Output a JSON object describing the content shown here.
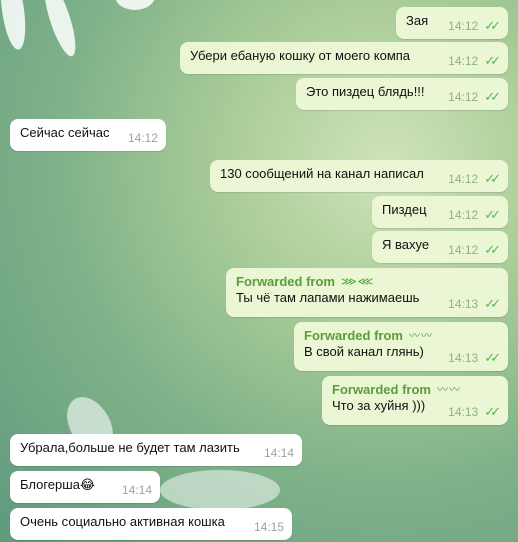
{
  "messages": [
    {
      "text": "Зая",
      "time": "14:12"
    },
    {
      "text": "Убери ебаную кошку от моего компа",
      "time": "14:12"
    },
    {
      "text": "Это пиздец блядь!!!",
      "time": "14:12"
    },
    {
      "text": "Сейчас сейчас",
      "time": "14:12"
    },
    {
      "text": "130 сообщений на канал написал",
      "time": "14:12"
    },
    {
      "text": "Пиздец",
      "time": "14:12"
    },
    {
      "text": "Я вахуе",
      "time": "14:12"
    },
    {
      "forwarded": "Forwarded from",
      "from_name": "⋙⋘",
      "text": "Ты чё там лапами нажимаешь",
      "time": "14:13"
    },
    {
      "forwarded": "Forwarded from",
      "from_name": "〰〰",
      "text": "В свой канал глянь)",
      "time": "14:13"
    },
    {
      "forwarded": "Forwarded from",
      "from_name": "〰〰",
      "text": "Что за хуйня )))",
      "time": "14:13"
    },
    {
      "text": "Убрала,больше не будет там лазить",
      "time": "14:14"
    },
    {
      "text": "Блогерша😂",
      "time": "14:14"
    },
    {
      "text": "Очень социально активная кошка",
      "time": "14:15"
    }
  ],
  "colors": {
    "outgoing": "#eaf6d4",
    "incoming": "#ffffff",
    "read_check": "#5cb64f",
    "forward_label": "#5a9d3c"
  },
  "icons": {
    "read": "double-check-icon"
  }
}
